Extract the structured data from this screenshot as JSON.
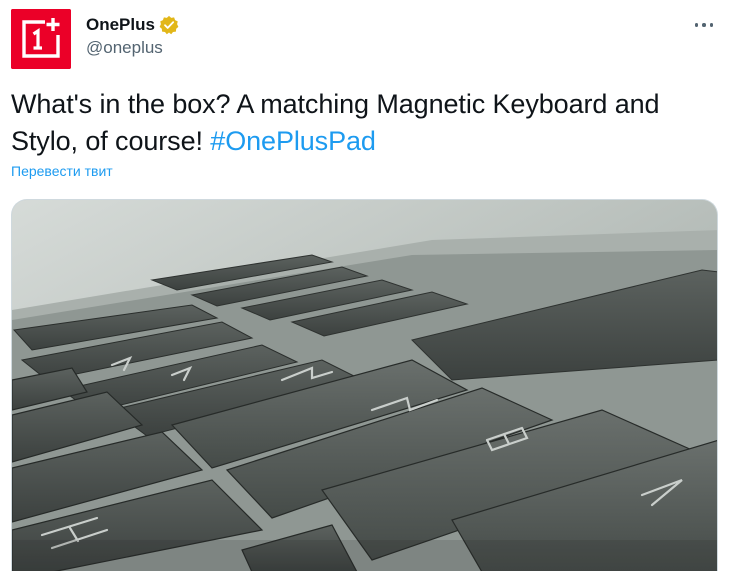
{
  "author": {
    "display_name": "OnePlus",
    "handle": "@oneplus",
    "avatar_icon": "oneplus-logo-icon",
    "verified_icon": "verified-badge-icon",
    "brand_color": "#eb0028",
    "verified_color": "#e2b719"
  },
  "tweet": {
    "text": "What's in the box? A matching Magnetic Keyboard and Stylo, of course! ",
    "hashtag": "#OnePlusPad",
    "translate_label": "Перевести твит",
    "more_icon": "more-options-icon",
    "link_color": "#1d9bf0"
  },
  "media": {
    "type": "image",
    "subject": "keyboard-keys-photo",
    "key_legends": [
      "N",
      "N",
      "B",
      "H",
      "V"
    ]
  }
}
